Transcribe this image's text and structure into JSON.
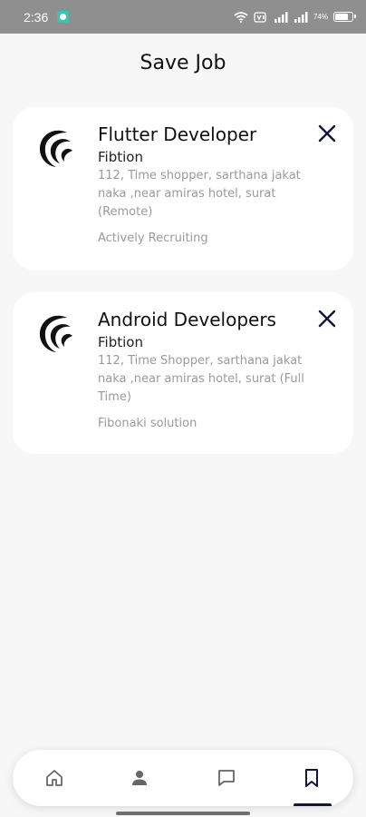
{
  "status_bar": {
    "time": "2:36",
    "battery": "74%",
    "icons": [
      "app-notification-icon",
      "wifi-icon",
      "volte-icon",
      "signal-icon",
      "signal-icon",
      "battery-icon"
    ]
  },
  "header": {
    "title": "Save Job"
  },
  "saved_jobs": [
    {
      "title": "Flutter Developer",
      "company": "Fibtion",
      "address": "112, Time shopper, sarthana jakat naka ,near amiras hotel, surat (Remote)",
      "extra": "Actively Recruiting"
    },
    {
      "title": "Android Developers",
      "company": "Fibtion",
      "address": "112, Time Shopper, sarthana jakat naka ,near amiras hotel, surat (Full Time)",
      "extra": "Fibonaki solution"
    }
  ],
  "bottom_nav": {
    "items": [
      {
        "icon": "home-icon",
        "active": false
      },
      {
        "icon": "profile-icon",
        "active": false
      },
      {
        "icon": "chat-icon",
        "active": false
      },
      {
        "icon": "bookmark-icon",
        "active": true
      }
    ],
    "active_color": "#12163a"
  },
  "colors": {
    "background": "#f7f7f7",
    "card": "#ffffff",
    "status_bar": "#8f8f8f",
    "secondary_text": "#9a9a9a"
  }
}
